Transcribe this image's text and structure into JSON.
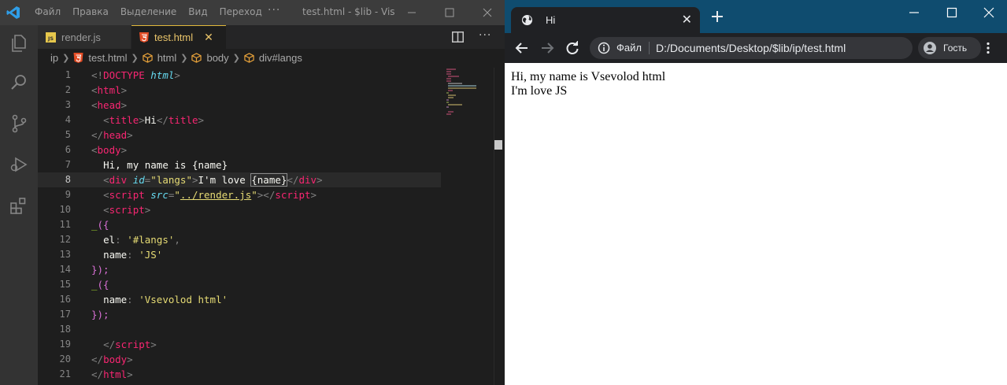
{
  "vscode": {
    "menu": [
      "Файл",
      "Правка",
      "Выделение",
      "Вид",
      "Переход"
    ],
    "more": "···",
    "window_title": "test.html - $lib - Vis...",
    "tabs": [
      {
        "icon": "js-file-icon",
        "badge": "JS",
        "label": "render.js",
        "active": false
      },
      {
        "icon": "html5-icon",
        "label": "test.html",
        "active": true,
        "close": "✕"
      }
    ],
    "breadcrumb": [
      "ip",
      "test.html",
      "html",
      "body",
      "div#langs"
    ],
    "line_numbers": [
      "1",
      "2",
      "3",
      "4",
      "5",
      "6",
      "7",
      "8",
      "9",
      "10",
      "11",
      "12",
      "13",
      "14",
      "15",
      "16",
      "17",
      "18",
      "19",
      "20",
      "21"
    ],
    "current_line": 8,
    "code": {
      "l1_open": "<!",
      "l1_doctype": "DOCTYPE",
      "l1_html": "html",
      "l1_close": ">",
      "l2": "html",
      "l3": "head",
      "l4_title_open": "title",
      "l4_text": "Hi",
      "l4_title_close": "title",
      "l5": "head",
      "l6": "body",
      "l7": "Hi, my name is {name}",
      "l8_div": "div",
      "l8_attr": "id",
      "l8_val": "\"langs\"",
      "l8_text_a": "I'm love ",
      "l8_text_b": "{name}",
      "l8_div_close": "div",
      "l9_script": "script",
      "l9_attr": "src",
      "l9_val": "../render.js",
      "l9_script_close": "script",
      "l10": "script",
      "l11_fn": "_",
      "l11_open": "({",
      "l12_key": "el",
      "l12_val": "'#langs'",
      "l13_key": "name",
      "l13_val": "'JS'",
      "l14": "});",
      "l15_fn": "_",
      "l15_open": "({",
      "l16_key": "name",
      "l16_val": "'Vsevolod html'",
      "l17": "});",
      "l19": "script",
      "l20": "body",
      "l21": "html"
    },
    "colors": {
      "tag": "#f92672",
      "attr": "#66d9ef",
      "string": "#e6db74",
      "function": "#a6e22e",
      "active_tab": "#e2b93b"
    }
  },
  "browser": {
    "tab_title": "Hi",
    "tab_close": "✕",
    "omnibox_scheme_label": "Файл",
    "url": "D:/Documents/Desktop/$lib/ip/test.html",
    "profile_label": "Гость",
    "content": {
      "line1": "Hi, my name is Vsevolod html",
      "line2": "I'm love JS"
    },
    "colors": {
      "frame": "#0f4c6f",
      "toolbar": "#202124"
    }
  }
}
